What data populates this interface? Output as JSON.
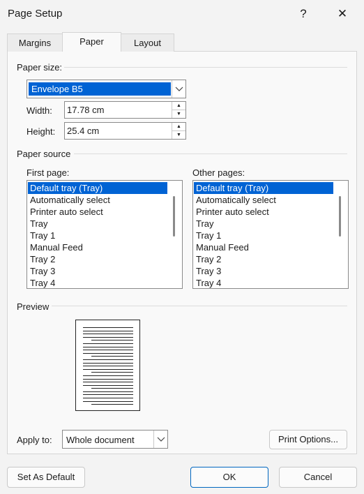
{
  "window": {
    "title": "Page Setup",
    "help_glyph": "?",
    "close_glyph": "✕"
  },
  "tabs": [
    {
      "label": "Margins"
    },
    {
      "label": "Paper"
    },
    {
      "label": "Layout"
    }
  ],
  "paper_size": {
    "section_label": "Paper size:",
    "selected": "Envelope B5",
    "width_label": "Width:",
    "width_value": "17.78 cm",
    "height_label": "Height:",
    "height_value": "25.4 cm"
  },
  "paper_source": {
    "section_label": "Paper source",
    "first_page_label": "First page:",
    "other_pages_label": "Other pages:",
    "first_page_items": [
      "Default tray (Tray)",
      "Automatically select",
      "Printer auto select",
      "Tray",
      "Tray 1",
      "Manual Feed",
      "Tray 2",
      "Tray 3",
      "Tray 4"
    ],
    "other_pages_items": [
      "Default tray (Tray)",
      "Automatically select",
      "Printer auto select",
      "Tray",
      "Tray 1",
      "Manual Feed",
      "Tray 2",
      "Tray 3",
      "Tray 4"
    ],
    "selected_index": 0
  },
  "preview": {
    "section_label": "Preview"
  },
  "apply_to": {
    "label": "Apply to:",
    "value": "Whole document"
  },
  "buttons": {
    "print_options": "Print Options...",
    "set_default": "Set As Default",
    "ok": "OK",
    "cancel": "Cancel"
  },
  "colors": {
    "selection": "#0063d4",
    "accent_border": "#0067c0"
  },
  "icons": {
    "dropdown": "chevron-down-icon",
    "spin_up": "spin-up-icon",
    "spin_down": "spin-down-icon"
  }
}
